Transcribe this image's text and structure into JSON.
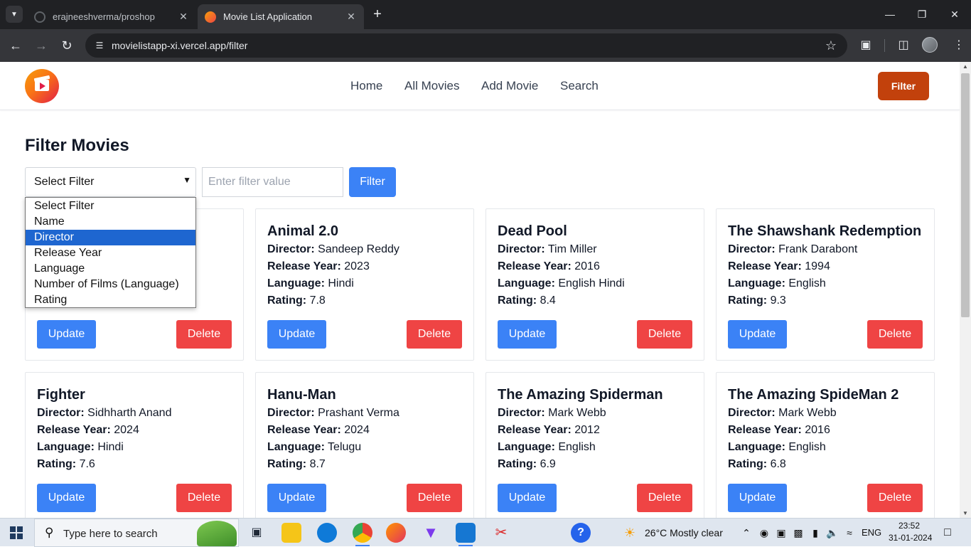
{
  "browser": {
    "tabs": [
      {
        "title": "erajneeshverma/proshop",
        "active": false
      },
      {
        "title": "Movie List Application",
        "active": true
      }
    ],
    "url": "movielistapp-xi.vercel.app/filter"
  },
  "navbar": {
    "links": [
      "Home",
      "All Movies",
      "Add Movie",
      "Search"
    ],
    "filter_button": "Filter"
  },
  "filter_page": {
    "heading": "Filter Movies",
    "select_value": "Select Filter",
    "input_placeholder": "Enter filter value",
    "filter_button": "Filter",
    "dropdown_options": [
      "Select Filter",
      "Name",
      "Director",
      "Release Year",
      "Language",
      "Number of Films (Language)",
      "Rating"
    ],
    "highlighted_option": "Director"
  },
  "labels": {
    "director": "Director:",
    "release_year": "Release Year:",
    "language": "Language:",
    "rating": "Rating:",
    "update": "Update",
    "delete": "Delete"
  },
  "movies": [
    {
      "title": "",
      "director": "",
      "year": "",
      "language": "",
      "rating": "",
      "hidden": true
    },
    {
      "title": "Animal 2.0",
      "director": "Sandeep Reddy",
      "year": "2023",
      "language": "Hindi",
      "rating": "7.8"
    },
    {
      "title": "Dead Pool",
      "director": "Tim Miller",
      "year": "2016",
      "language": "English Hindi",
      "rating": "8.4"
    },
    {
      "title": "The Shawshank Redemption",
      "director": "Frank Darabont",
      "year": "1994",
      "language": "English",
      "rating": "9.3"
    },
    {
      "title": "Fighter",
      "director": "Sidhharth Anand",
      "year": "2024",
      "language": "Hindi",
      "rating": "7.6"
    },
    {
      "title": "Hanu-Man",
      "director": "Prashant Verma",
      "year": "2024",
      "language": "Telugu",
      "rating": "8.7"
    },
    {
      "title": "The Amazing Spiderman",
      "director": "Mark Webb",
      "year": "2012",
      "language": "English",
      "rating": "6.9"
    },
    {
      "title": "The Amazing SpideMan 2",
      "director": "Mark Webb",
      "year": "2016",
      "language": "English",
      "rating": "6.8"
    }
  ],
  "taskbar": {
    "search_placeholder": "Type here to search",
    "weather": "26°C  Mostly clear",
    "language": "ENG",
    "time": "23:52",
    "date": "31-01-2024"
  },
  "colors": {
    "primary_blue": "#3b82f6",
    "delete_red": "#ef4444",
    "nav_filter": "#c2410c"
  }
}
